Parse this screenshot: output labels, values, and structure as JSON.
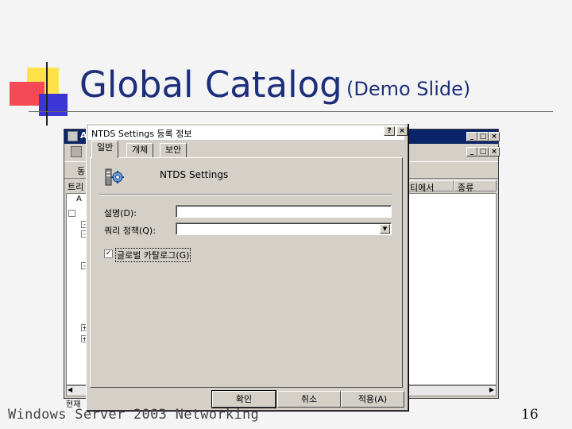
{
  "slide": {
    "title": "Global Catalog",
    "subtitle": "(Demo Slide)",
    "footer": "Windows  Server 2003 Networking",
    "page_number": "16"
  },
  "bg_window": {
    "title": "AD",
    "toolbar_text": "동",
    "tree_header": "트리",
    "tree_item_a": "A",
    "columns": [
      "티에서",
      "종류"
    ],
    "status_text": "현재"
  },
  "dialog": {
    "title": "NTDS Settings 등록 정보",
    "tabs": [
      "일반",
      "개체",
      "보안"
    ],
    "active_tab": 0,
    "object_name": "NTDS Settings",
    "description_label": "설명(D):",
    "description_value": "",
    "query_policy_label": "쿼리 정책(Q):",
    "query_policy_value": "",
    "global_catalog_label": "글로벌 카탈로그(G)",
    "global_catalog_checked": true,
    "buttons": {
      "ok": "확인",
      "cancel": "취소",
      "apply": "적용(A)"
    },
    "title_buttons": {
      "help": "?",
      "close": "×"
    }
  },
  "colors": {
    "title_text": "#1d2f7a",
    "deco_yellow": "#ffe24a",
    "deco_red": "#f44a55",
    "deco_blue": "#3d36d6",
    "window_face": "#d4d0c8",
    "titlebar_active": "#0a246a"
  }
}
